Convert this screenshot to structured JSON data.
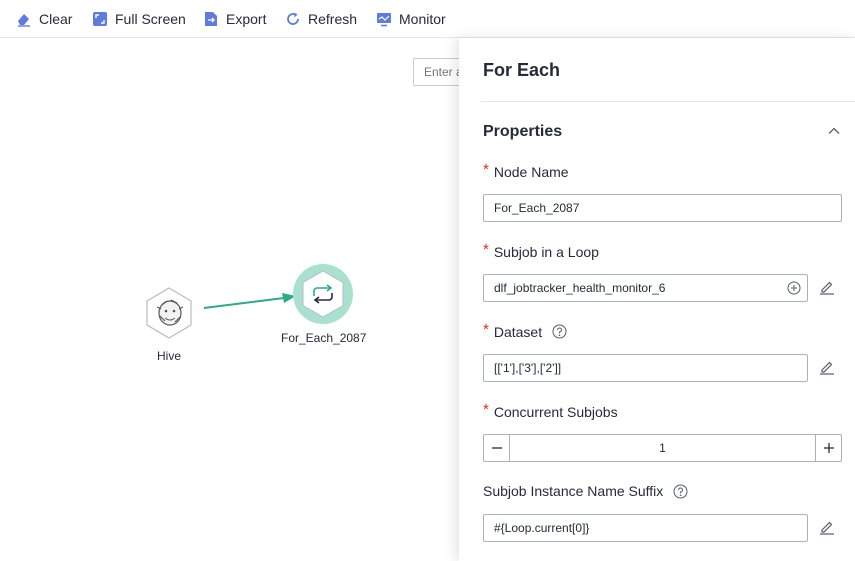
{
  "toolbar": {
    "clear": "Clear",
    "full_screen": "Full Screen",
    "export": "Export",
    "refresh": "Refresh",
    "monitor": "Monitor"
  },
  "canvas": {
    "search_placeholder": "Enter a",
    "nodes": [
      {
        "label": "Hive",
        "icon": "hive-icon"
      },
      {
        "label": "For_Each_2087",
        "icon": "loop-icon",
        "selected": true
      }
    ]
  },
  "panel": {
    "title": "For Each",
    "section": "Properties",
    "fields": {
      "node_name": {
        "label": "Node Name",
        "required": true,
        "value": "For_Each_2087"
      },
      "subjob": {
        "label": "Subjob in a Loop",
        "required": true,
        "value": "dlf_jobtracker_health_monitor_6"
      },
      "dataset": {
        "label": "Dataset",
        "required": true,
        "value": "[['1'],['3'],['2']]"
      },
      "concurrent": {
        "label": "Concurrent Subjobs",
        "required": true,
        "value": "1"
      },
      "suffix": {
        "label": "Subjob Instance Name Suffix",
        "required": false,
        "value": "#{Loop.current[0]}"
      }
    }
  },
  "colors": {
    "accent_teal": "#2bab8c",
    "selected_ring": "#a8e2cf",
    "toolbar_icon": "#5e7ce0",
    "required": "#e5282c"
  }
}
